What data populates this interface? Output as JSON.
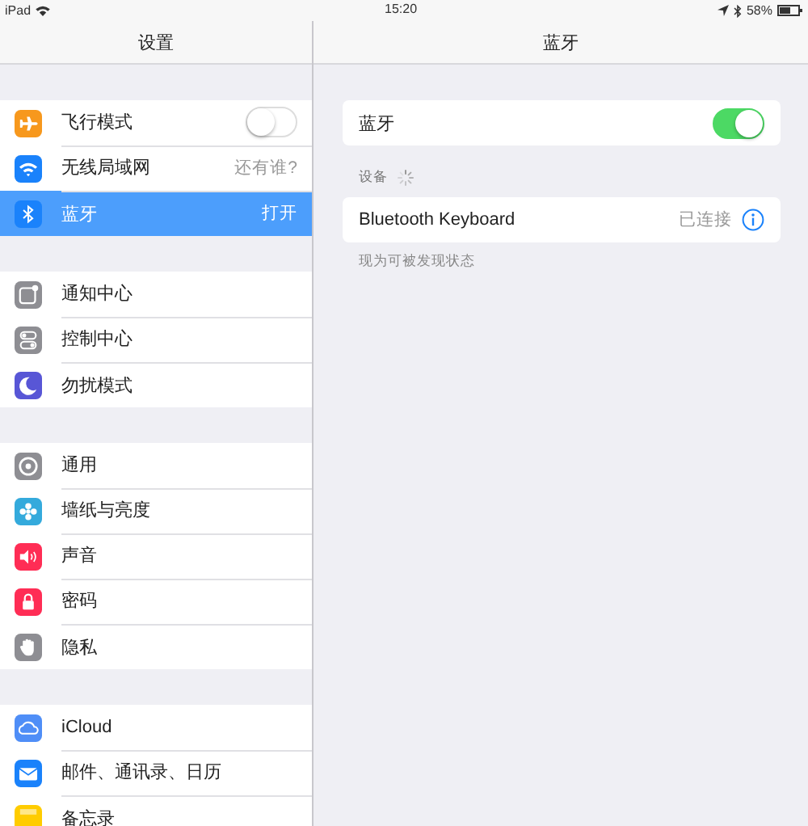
{
  "status_bar": {
    "device": "iPad",
    "time": "15:20",
    "battery": "58%"
  },
  "sidebar": {
    "title": "设置",
    "groups": [
      {
        "items": [
          {
            "label": "飞行模式",
            "kind": "toggle",
            "on": false,
            "selected": false,
            "color": "#f7981d"
          },
          {
            "label": "无线局域网",
            "kind": "value",
            "value": "还有谁?",
            "selected": false,
            "color": "#1a82fb"
          },
          {
            "label": "蓝牙",
            "kind": "value",
            "value": "打开",
            "selected": true,
            "color": "#1a82fb"
          }
        ]
      },
      {
        "items": [
          {
            "label": "通知中心",
            "kind": "plain",
            "selected": false,
            "color": "#8e8e93"
          },
          {
            "label": "控制中心",
            "kind": "plain",
            "selected": false,
            "color": "#8e8e93"
          },
          {
            "label": "勿扰模式",
            "kind": "plain",
            "selected": false,
            "color": "#5856d6"
          }
        ]
      },
      {
        "items": [
          {
            "label": "通用",
            "kind": "plain",
            "selected": false,
            "color": "#8e8e93"
          },
          {
            "label": "墙纸与亮度",
            "kind": "plain",
            "selected": false,
            "color": "#34aadc"
          },
          {
            "label": "声音",
            "kind": "plain",
            "selected": false,
            "color": "#ff2d55"
          },
          {
            "label": "密码",
            "kind": "plain",
            "selected": false,
            "color": "#ff2d55"
          },
          {
            "label": "隐私",
            "kind": "plain",
            "selected": false,
            "color": "#8e8e93"
          }
        ]
      },
      {
        "items": [
          {
            "label": "iCloud",
            "kind": "plain",
            "selected": false,
            "color": "#4f8ef7"
          },
          {
            "label": "邮件、通讯录、日历",
            "kind": "plain",
            "selected": false,
            "color": "#1a82fb"
          },
          {
            "label": "备忘录",
            "kind": "plain",
            "selected": false,
            "color": "#ffcc00"
          }
        ]
      }
    ]
  },
  "detail": {
    "title": "蓝牙",
    "bluetooth": {
      "label": "蓝牙",
      "on": true
    },
    "devices_header": "设备",
    "devices": [
      {
        "name": "Bluetooth Keyboard",
        "status": "已连接"
      }
    ],
    "footer": "现为可被发现状态"
  }
}
